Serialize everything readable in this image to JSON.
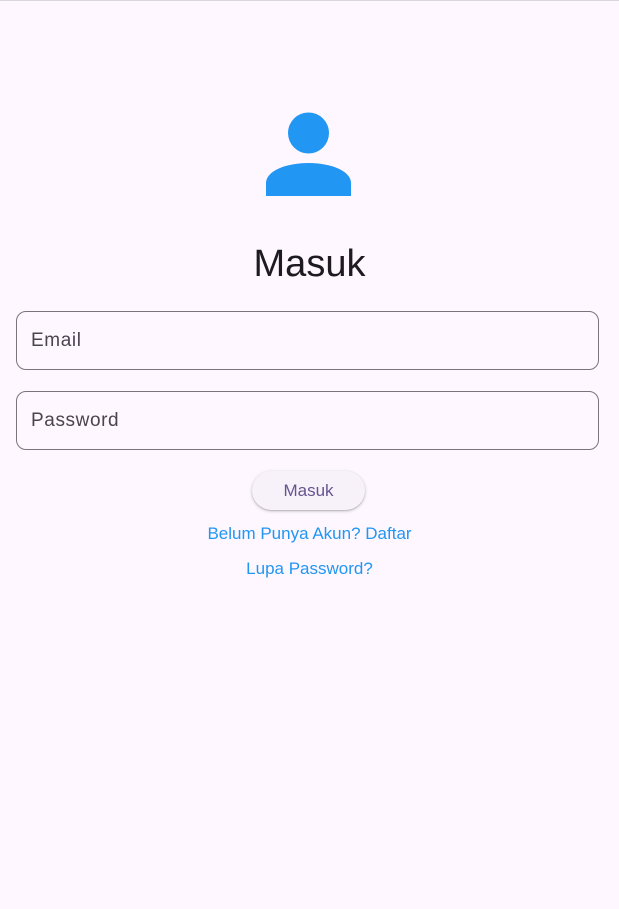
{
  "login": {
    "title": "Masuk",
    "email": {
      "placeholder": "Email",
      "value": ""
    },
    "password": {
      "placeholder": "Password",
      "value": ""
    },
    "submit_label": "Masuk",
    "register_link": "Belum Punya Akun? Daftar",
    "forgot_link": "Lupa Password?"
  },
  "icons": {
    "avatar": "person-icon"
  },
  "colors": {
    "background": "#FEF7FF",
    "accent": "#2196F3",
    "button_text": "#65558F",
    "title": "#1D1B20",
    "outline": "#79747E"
  }
}
